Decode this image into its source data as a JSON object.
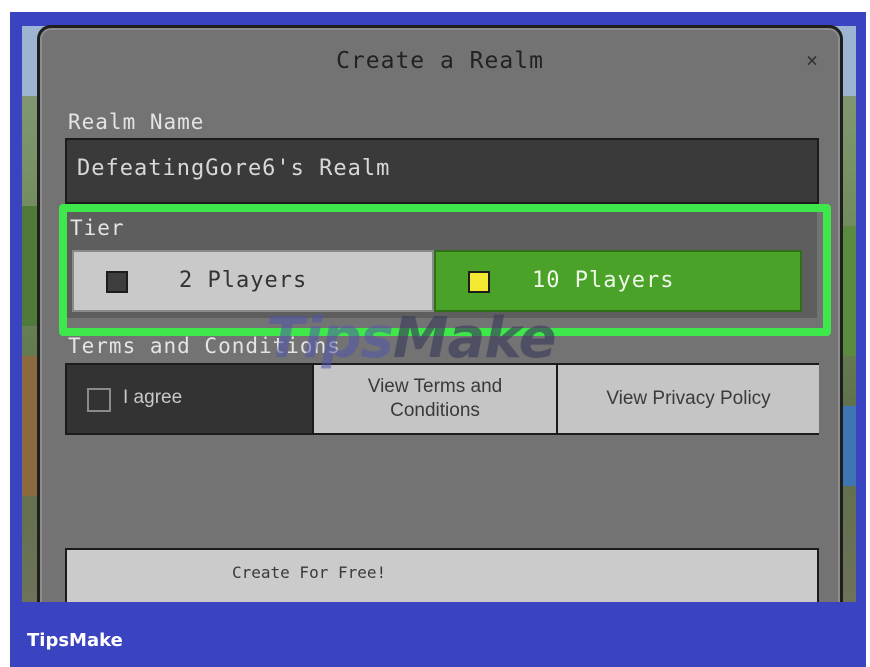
{
  "dialog": {
    "title": "Create a Realm",
    "close_glyph": "×",
    "realm_name_label": "Realm Name",
    "realm_name_value": "DefeatingGore6's Realm",
    "tier_label": "Tier",
    "tiers": [
      {
        "label": "2 Players",
        "selected": false
      },
      {
        "label": "10 Players",
        "selected": true
      }
    ],
    "terms_label": "Terms and Conditions",
    "agree_label": "I agree",
    "view_terms_label": "View Terms and Conditions",
    "view_privacy_label": "View Privacy Policy",
    "create_label": "Create For Free!"
  },
  "watermark": {
    "part1": "Tips",
    "part2": "Make"
  },
  "caption": "TipsMake",
  "colors": {
    "frame": "#3b44c0",
    "highlight": "#3ee84a",
    "selected_tier": "#4aa228",
    "dialog": "#737373"
  },
  "icons": [
    "close-icon",
    "checkbox-icon"
  ]
}
